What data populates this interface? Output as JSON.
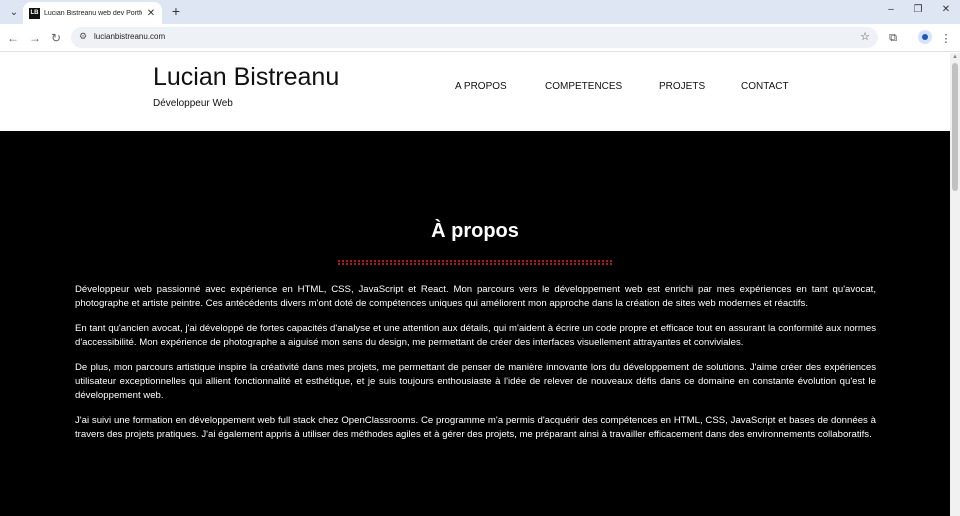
{
  "browser": {
    "tab_title": "Lucian Bistreanu web dev Portfolio",
    "favicon_text": "LB",
    "url": "lucianbistreanu.com"
  },
  "header": {
    "name": "Lucian Bistreanu",
    "subtitle": "Développeur Web",
    "nav": [
      "A PROPOS",
      "COMPETENCES",
      "PROJETS",
      "CONTACT"
    ]
  },
  "about": {
    "title": "À propos",
    "paragraphs": [
      "Développeur web passionné avec expérience en HTML, CSS, JavaScript et React. Mon parcours vers le développement web est enrichi par mes expériences en tant qu'avocat, photographe et artiste peintre. Ces antécédents divers m'ont doté de compétences uniques qui améliorent mon approche dans la création de sites web modernes et réactifs.",
      "En tant qu'ancien avocat, j'ai développé de fortes capacités d'analyse et une attention aux détails, qui m'aident à écrire un code propre et efficace tout en assurant la conformité aux normes d'accessibilité. Mon expérience de photographe a aiguisé mon sens du design, me permettant de créer des interfaces visuellement attrayantes et conviviales.",
      "De plus, mon parcours artistique inspire la créativité dans mes projets, me permettant de penser de manière innovante lors du développement de solutions. J'aime créer des expériences utilisateur exceptionnelles qui allient fonctionnalité et esthétique, et je suis toujours enthousiaste à l'idée de relever de nouveaux défis dans ce domaine en constante évolution qu'est le développement web.",
      "J'ai suivi une formation en développement web full stack chez OpenClassrooms. Ce programme m'a permis d'acquérir des compétences en HTML, CSS, JavaScript et bases de données à travers des projets pratiques. J'ai également appris à utiliser des méthodes agiles et à gérer des projets, me préparant ainsi à travailler efficacement dans des environnements collaboratifs."
    ]
  },
  "colors": {
    "accent_rule": "#b81414",
    "tabstrip": "#dfe6f3",
    "page_bg": "#000000"
  },
  "icons": {
    "tab_menu": "chevron-down-icon",
    "tab_close": "close-icon",
    "new_tab": "plus-icon",
    "back": "arrow-left-icon",
    "forward": "arrow-right-icon",
    "reload": "reload-icon",
    "site_info": "tune-icon",
    "bookmark": "star-icon",
    "extensions": "puzzle-icon",
    "profile": "person-icon",
    "menu": "kebab-icon"
  }
}
